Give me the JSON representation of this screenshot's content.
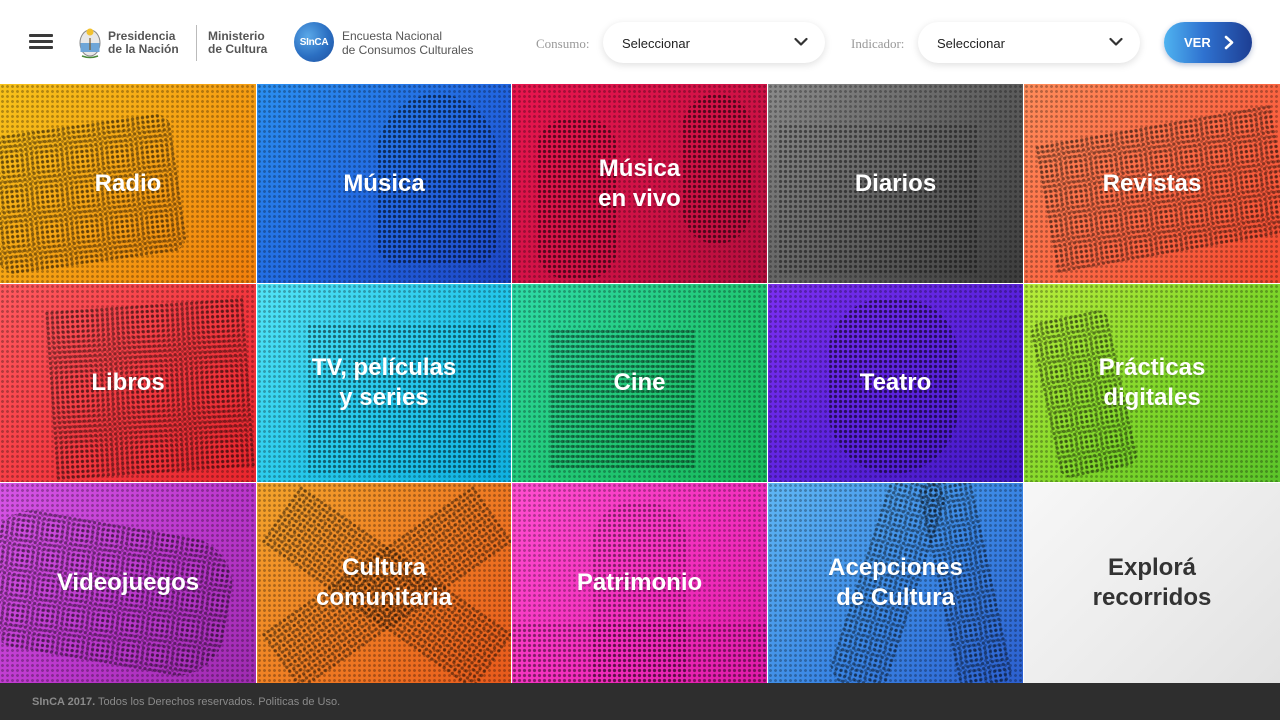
{
  "header": {
    "presidencia": "Presidencia\nde la Nación",
    "ministerio": "Ministerio\nde Cultura",
    "sinca_badge": "SInCA",
    "encuesta": "Encuesta Nacional\nde Consumos Culturales",
    "consumo_label": "Consumo:",
    "consumo_value": "Seleccionar",
    "indicador_label": "Indicador:",
    "indicador_value": "Seleccionar",
    "ver_label": "VER",
    "icons": {
      "menu": "hamburger-menu-icon",
      "escudo": "argentina-coat-of-arms-icon",
      "chevron": "chevron-down-icon",
      "arrow": "chevron-right-icon"
    }
  },
  "tiles": [
    {
      "label": "Radio",
      "color": "#f59a12"
    },
    {
      "label": "Música",
      "color": "#2266e0"
    },
    {
      "label": "Música\nen vivo",
      "color": "#cf1246"
    },
    {
      "label": "Diarios",
      "color": "#5d5d5d"
    },
    {
      "label": "Revistas",
      "color": "#fb6643"
    },
    {
      "label": "Libros",
      "color": "#f3383f"
    },
    {
      "label": "TV, películas\ny series",
      "color": "#24c6ea"
    },
    {
      "label": "Cine",
      "color": "#21c774"
    },
    {
      "label": "Teatro",
      "color": "#5a22dc"
    },
    {
      "label": "Prácticas\ndigitales",
      "color": "#7fd62a"
    },
    {
      "label": "Videojuegos",
      "color": "#bb37cc"
    },
    {
      "label": "Cultura\ncomunitaria",
      "color": "#ef7a23"
    },
    {
      "label": "Patrimonio",
      "color": "#f22fbd"
    },
    {
      "label": "Acepciones\nde Cultura",
      "color": "#3a86e4"
    },
    {
      "label": "Explorá\nrecorridos",
      "color": "#ececec"
    }
  ],
  "footer": {
    "brand": "SInCA 2017.",
    "text": " Todos los Derechos reservados. Politicas de Uso."
  }
}
